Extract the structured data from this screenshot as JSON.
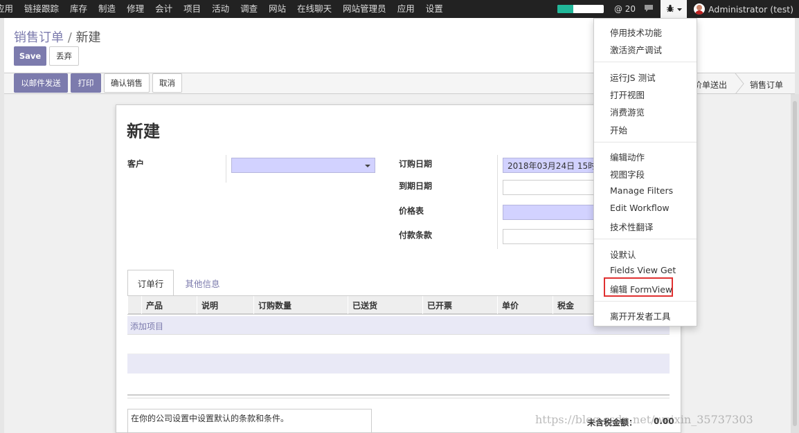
{
  "navbar": {
    "menu": [
      "应用",
      "链接跟踪",
      "库存",
      "制造",
      "修理",
      "会计",
      "项目",
      "活动",
      "调查",
      "网站",
      "在线聊天",
      "网站管理员",
      "应用",
      "设置"
    ],
    "progress_fraction": 0.35,
    "messages": "@ 20",
    "user": "Administrator (test)"
  },
  "breadcrumb": {
    "parent": "销售订单",
    "separator": "/",
    "current": "新建"
  },
  "buttons": {
    "save": "Save",
    "discard": "丢弃"
  },
  "statusbar": {
    "buttons": [
      "以邮件发送",
      "打印",
      "确认销售",
      "取消"
    ],
    "stages": [
      "价单送出",
      "销售订单"
    ]
  },
  "form": {
    "title": "新建",
    "customer_label": "客户",
    "order_date_label": "订购日期",
    "order_date_value": "2018年03月24日 15时",
    "expiry_label": "到期日期",
    "pricelist_label": "价格表",
    "payment_terms_label": "付款条款"
  },
  "tabs": [
    "订单行",
    "其他信息"
  ],
  "lines_table": {
    "columns": [
      "产品",
      "说明",
      "订购数量",
      "已送货",
      "已开票",
      "单价",
      "税金"
    ],
    "add_item": "添加项目"
  },
  "note_placeholder": "在你的公司设置中设置默认的条款和条件。",
  "totals": {
    "untaxed_label": "未含税金额：",
    "untaxed_value": "0.00"
  },
  "watermark": "https://blog.csdn.net/weixin_35737303",
  "debug_menu": {
    "group1": [
      "停用技术功能",
      "激活资产调试"
    ],
    "group2": [
      "运行JS 测试",
      "打开视图",
      "消费游览",
      "开始"
    ],
    "group3": [
      "编辑动作",
      "视图字段",
      "Manage Filters",
      "Edit Workflow",
      "技术性翻译"
    ],
    "group4": [
      "设默认",
      "Fields View Get",
      "编辑 FormView"
    ],
    "group5": [
      "离开开发者工具"
    ]
  },
  "colors": {
    "primary": "#7c7bad",
    "required_field": "#d2d2ff",
    "navbar": "#222222",
    "highlight": "#e03030"
  }
}
